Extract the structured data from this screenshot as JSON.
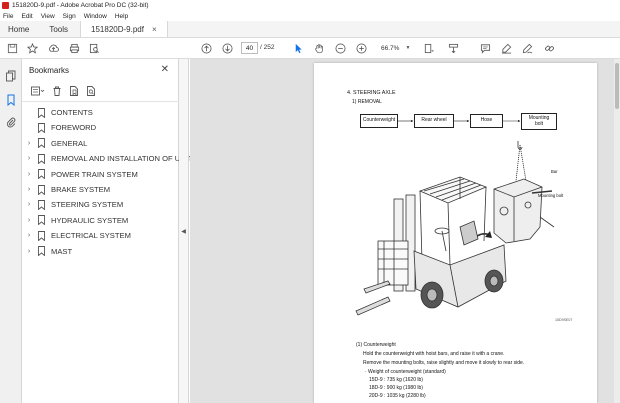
{
  "window": {
    "title": "151820D-9.pdf - Adobe Acrobat Pro DC (32-bit)"
  },
  "menu": [
    "File",
    "Edit",
    "View",
    "Sign",
    "Window",
    "Help"
  ],
  "tabs": {
    "home": "Home",
    "tools": "Tools",
    "document": "151820D-9.pdf",
    "close_glyph": "×"
  },
  "toolbar": {
    "current_page": "40",
    "page_total": "/ 252",
    "zoom": "66.7%",
    "icons": [
      "save-icon",
      "bookmark-star-icon",
      "upload-icon",
      "print-icon",
      "find-icon",
      "page-up-icon",
      "page-down-icon",
      "select-cursor-icon",
      "hand-icon",
      "zoom-out-icon",
      "zoom-in-icon",
      "fit-page-icon",
      "scroll-mode-icon",
      "comment-icon",
      "highlight-icon",
      "fill-sign-icon",
      "share-link-icon"
    ]
  },
  "bookmarks_panel": {
    "title": "Bookmarks",
    "close_glyph": "✕",
    "items": [
      {
        "label": "CONTENTS",
        "expandable": false
      },
      {
        "label": "FOREWORD",
        "expandable": false
      },
      {
        "label": "GENERAL",
        "expandable": true
      },
      {
        "label": "REMOVAL AND INSTALLATION OF UNIT",
        "expandable": true
      },
      {
        "label": "POWER TRAIN SYSTEM",
        "expandable": true
      },
      {
        "label": "BRAKE SYSTEM",
        "expandable": true
      },
      {
        "label": "STEERING SYSTEM",
        "expandable": true
      },
      {
        "label": "HYDRAULIC SYSTEM",
        "expandable": true
      },
      {
        "label": "ELECTRICAL SYSTEM",
        "expandable": true
      },
      {
        "label": "MAST",
        "expandable": true
      }
    ]
  },
  "document": {
    "heading": "4. STEERING AXLE",
    "subheading": "1) REMOVAL",
    "flow": [
      "Counterweight",
      "Rear wheel",
      "Hose",
      "Mounting bolt"
    ],
    "illustration_labels": {
      "bar": "Bar",
      "mounting_bolt": "Mounting bolt",
      "figure_code": "15D9SE07"
    },
    "step_title": "(1) Counterweight",
    "step_lines": [
      "Hold the counterweight with hoist bars, and raise it with a crane.",
      "Remove the mounting bolts, raise slightly and move it slowly to rear side.",
      "· Weight of counterweight (standard)",
      "15D-9 : 735 kg (1620 lb)",
      "18D-9 : 900 kg (1980 lb)",
      "20D-9 : 1035 kg (2280 lb)"
    ]
  },
  "colors": {
    "accent": "#1473e6",
    "acrobat_red": "#d6201e",
    "doc_background": "#e1e1e1"
  }
}
